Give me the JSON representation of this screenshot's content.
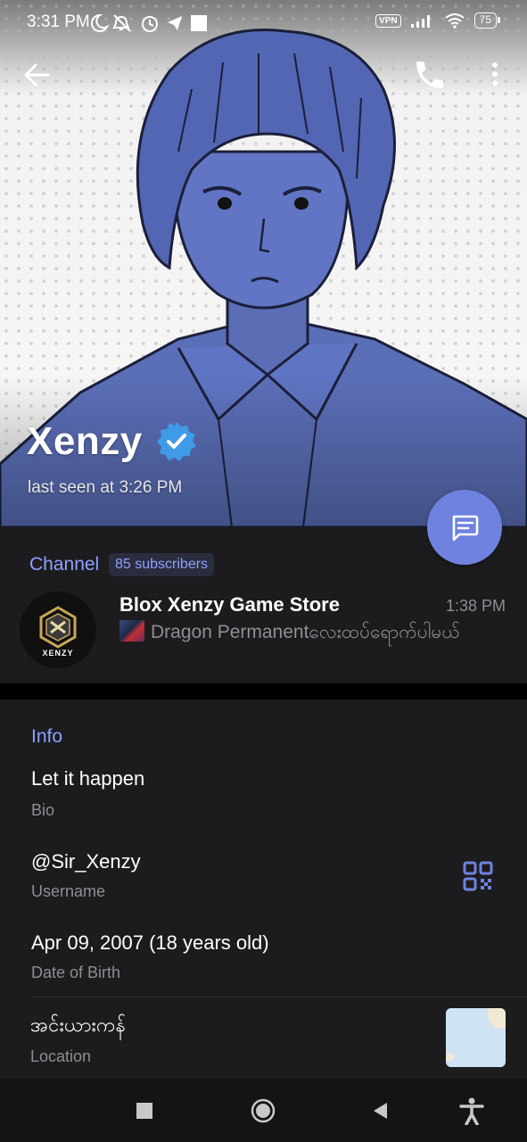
{
  "status_bar": {
    "time": "3:31 PM",
    "vpn": "VPN",
    "battery": "75"
  },
  "profile": {
    "name": "Xenzy",
    "last_seen": "last seen at 3:26 PM",
    "verified": true
  },
  "channel": {
    "label": "Channel",
    "subscribers": "85 subscribers",
    "title": "Blox Xenzy Game Store",
    "time": "1:38 PM",
    "preview": "Dragon Permanentလေးထပ်ရောက်ပါမယ်",
    "avatar_text": "XENZY"
  },
  "info": {
    "heading": "Info",
    "bio_value": "Let it happen",
    "bio_label": "Bio",
    "username_value": "@Sir_Xenzy",
    "username_label": "Username",
    "dob_value": "Apr 09, 2007 (18 years old)",
    "dob_label": "Date of Birth",
    "location_value": "အင်းယားကန်",
    "location_label": "Location"
  },
  "colors": {
    "accent": "#8fa0ff",
    "fab": "#6f82e0",
    "background": "#1c1c1e",
    "verified_badge": "#3f9ae8"
  },
  "icons": [
    "back-arrow-icon",
    "phone-icon",
    "more-vert-icon",
    "message-icon",
    "qr-code-icon",
    "verified-icon",
    "square-nav-icon",
    "home-circle-icon",
    "back-triangle-icon",
    "accessibility-icon"
  ]
}
